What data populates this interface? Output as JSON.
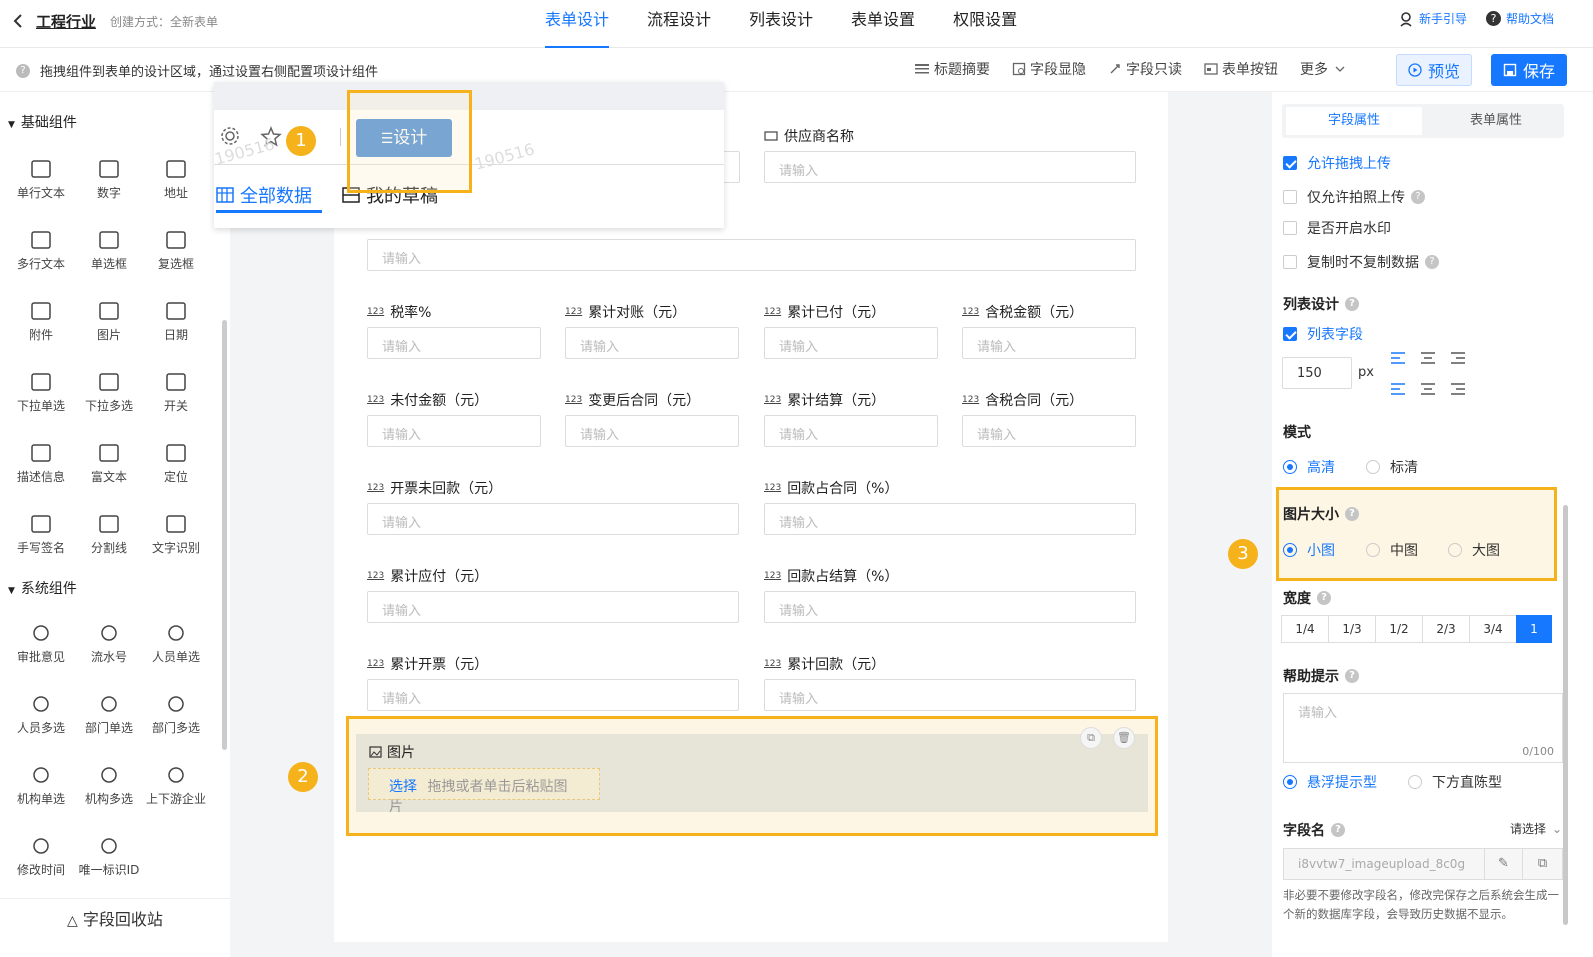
{
  "header": {
    "app_title": "工程行业",
    "create_method": "创建方式：全新表单",
    "tabs": [
      "表单设计",
      "流程设计",
      "列表设计",
      "表单设置",
      "权限设置"
    ],
    "guide": "新手引导",
    "help_doc": "帮助文档"
  },
  "subbar": {
    "hint": "拖拽组件到表单的设计区域，通过设置右侧配置项设计组件",
    "tools": [
      "标题摘要",
      "字段显隐",
      "字段只读",
      "表单按钮",
      "更多"
    ],
    "preview": "预览",
    "save": "保存"
  },
  "left": {
    "basic_title": "基础组件",
    "basic": [
      "单行文本",
      "数字",
      "地址",
      "多行文本",
      "单选框",
      "复选框",
      "附件",
      "图片",
      "日期",
      "下拉单选",
      "下拉多选",
      "开关",
      "描述信息",
      "富文本",
      "定位",
      "手写签名",
      "分割线",
      "文字识别"
    ],
    "system_title": "系统组件",
    "system": [
      "审批意见",
      "流水号",
      "人员单选",
      "人员多选",
      "部门单选",
      "部门多选",
      "机构单选",
      "机构多选",
      "上下游企业",
      "修改时间",
      "唯一标识ID"
    ],
    "recycle": "字段回收站"
  },
  "overlay": {
    "design_btn": "设计",
    "tab_all": "全部数据",
    "tab_draft": "我的草稿",
    "watermark": "190516"
  },
  "form": {
    "placeholder": "请输入",
    "supplier": "供应商名称",
    "num_icon": "123",
    "fields": [
      "税率%",
      "累计对账（元）",
      "累计已付（元）",
      "含税金额（元）",
      "未付金额（元）",
      "变更后合同（元）",
      "累计结算（元）",
      "含税合同（元）",
      "开票未回款（元）",
      "回款占合同（%）",
      "累计应付（元）",
      "回款占结算（%）",
      "累计开票（元）",
      "累计回款（元）"
    ],
    "image_label": "图片",
    "image_select": "选择",
    "image_hint": "拖拽或者单击后粘贴图片"
  },
  "badges": [
    "1",
    "2",
    "3"
  ],
  "right": {
    "tab_field": "字段属性",
    "tab_form": "表单属性",
    "allow_drag": "允许拖拽上传",
    "photo_only": "仅允许拍照上传",
    "watermark": "是否开启水印",
    "no_copy": "复制时不复制数据",
    "list_design": "列表设计",
    "list_field": "列表字段",
    "width_value": "150",
    "px": "px",
    "mode": "模式",
    "mode_hd": "高清",
    "mode_sd": "标清",
    "img_size": "图片大小",
    "small": "小图",
    "medium": "中图",
    "large": "大图",
    "width": "宽度",
    "width_opts": [
      "1/4",
      "1/3",
      "1/2",
      "2/3",
      "3/4",
      "1"
    ],
    "help": "帮助提示",
    "help_placeholder": "请输入",
    "counter": "0/100",
    "float_tip": "悬浮提示型",
    "below_tip": "下方直陈型",
    "field_name": "字段名",
    "select": "请选择",
    "field_name_value": "i8vvtw7_imageupload_8c0g",
    "note": "非必要不要修改字段名，修改完保存之后系统会生成一个新的数据库字段，会导致历史数据不显示。"
  },
  "colors": {
    "accent": "#1677ff",
    "highlight": "#f5b21b"
  }
}
